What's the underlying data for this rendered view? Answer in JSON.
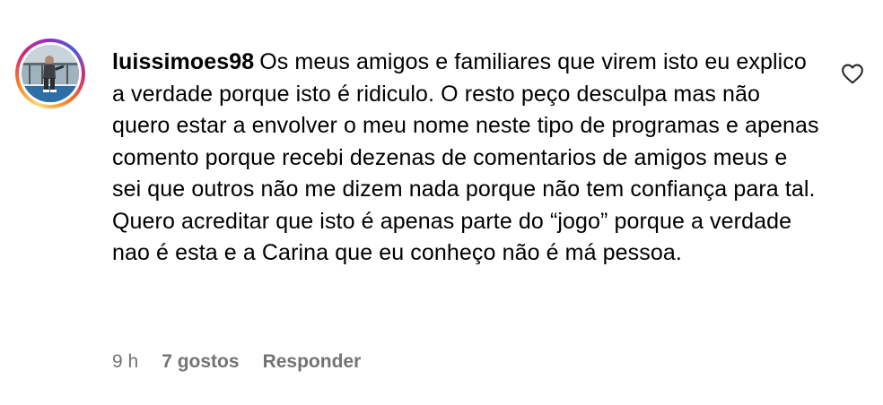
{
  "comment": {
    "username": "luissimoes98",
    "text": "Os meus amigos e familiares que virem isto eu explico a verdade porque isto é ridiculo. O resto peço desculpa mas não quero estar a envolver o meu nome neste tipo de programas e apenas comento porque recebi dezenas de comentarios de amigos meus e sei que outros não me dizem nada porque não tem confiança para tal. Quero acreditar que isto é apenas parte do “jogo” porque a verdade nao é esta e a Carina que eu conheço não é má pessoa.",
    "time": "9 h",
    "likes": "7 gostos",
    "reply_label": "Responder",
    "like_icon": "heart-outline-icon",
    "avatar_icon": "user-avatar-photo"
  },
  "colors": {
    "text": "#000000",
    "meta": "#737373",
    "story_ring_start": "#feda75",
    "story_ring_end": "#962fbf"
  }
}
